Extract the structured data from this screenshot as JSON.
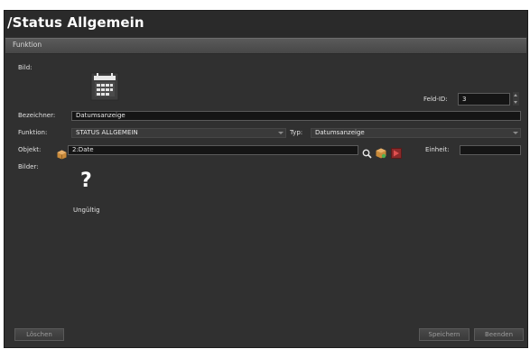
{
  "window": {
    "title": "/Status Allgemein"
  },
  "section": {
    "label": "Funktion"
  },
  "form": {
    "bild_label": "Bild:",
    "bild_icon": "calendar-icon",
    "feld_id_label": "Feld-ID:",
    "feld_id_value": "3",
    "bezeichner_label": "Bezeichner:",
    "bezeichner_value": "Datumsanzeige",
    "funktion_label": "Funktion:",
    "funktion_value": "STATUS ALLGEMEIN",
    "typ_label": "Typ:",
    "typ_value": "Datumsanzeige",
    "objekt_label": "Objekt:",
    "objekt_value": "2:Date",
    "einheit_label": "Einheit:",
    "einheit_value": "",
    "bilder_label": "Bilder:",
    "bilder_icon": "question-mark-icon",
    "bilder_caption": "Ungültig"
  },
  "footer": {
    "delete_label": "Löschen",
    "save_label": "Speichern",
    "exit_label": "Beenden"
  },
  "colors": {
    "background": "#303030",
    "title_bar": "#2a2a2a",
    "field_bg": "#151515",
    "object_icon": "#c98a3a",
    "delete_icon": "#c0392b"
  }
}
